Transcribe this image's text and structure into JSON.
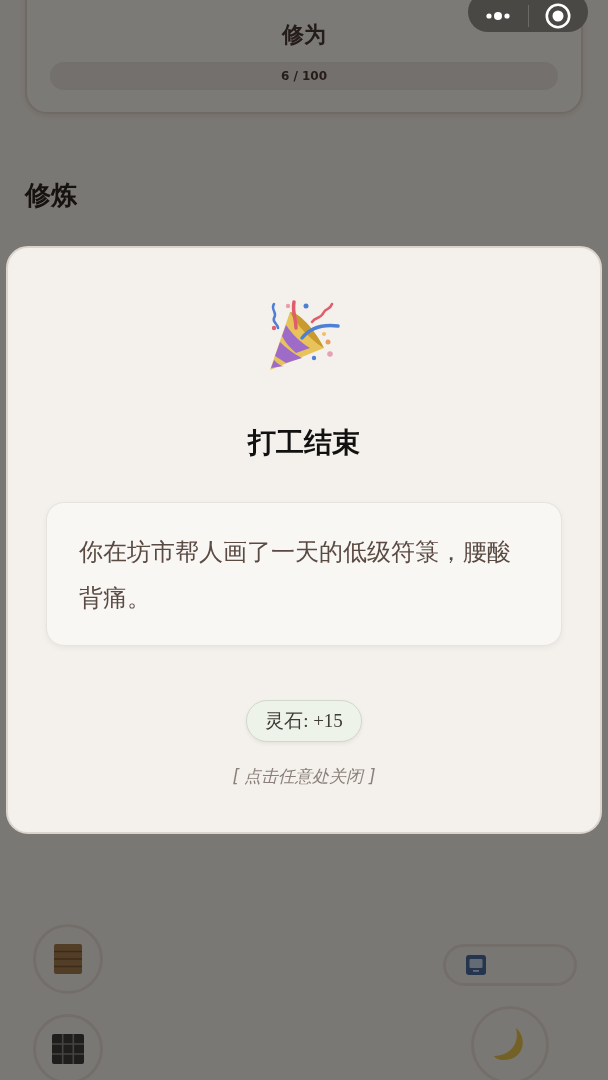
{
  "background": {
    "cultivation_card": {
      "title": "修为",
      "progress_text": "6 / 100"
    },
    "section_title": "修炼"
  },
  "modal": {
    "title": "打工结束",
    "message": "你在坊市帮人画了一天的低级符箓，腰酸背痛。",
    "reward": "灵石: +15",
    "hint": "[ 点击任意处关闭 ]"
  }
}
